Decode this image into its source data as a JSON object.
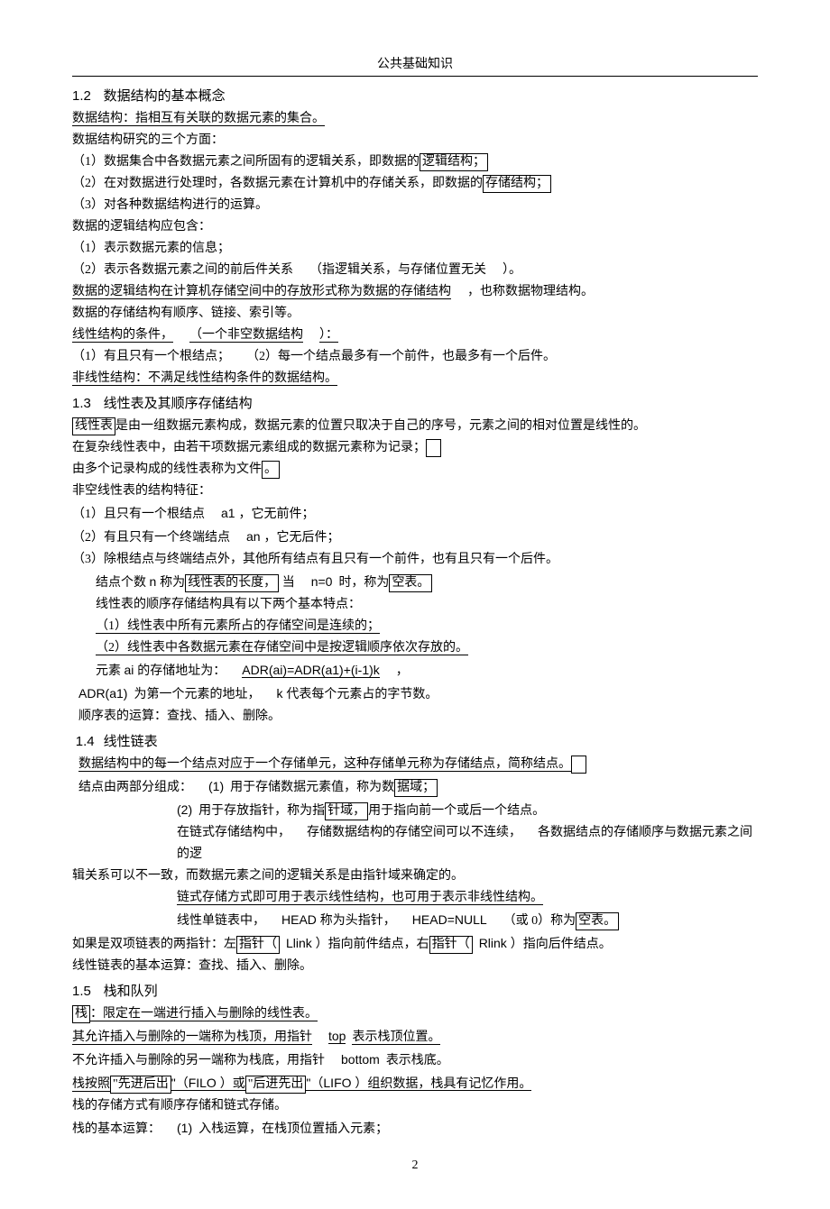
{
  "header": {
    "title": "公共基础知识"
  },
  "s12": {
    "num": "1.2",
    "title": "数据结构的基本概念",
    "p1a": "数据结构：指相互有关联的数据元素的集合。",
    "p2": "数据结构研究的三个方面：",
    "p3a": "（1）数据集合中各数据元素之间所固有的逻辑关系，即数据的",
    "p3b": "逻辑结构；",
    "p4a": "（2）在对数据进行处理时，各数据元素在计算机中的存储关系，即数据的",
    "p4b": "存储结构；",
    "p5": "（3）对各种数据结构进行的运算。",
    "p6": "数据的逻辑结构应包含：",
    "p7": "（1）表示数据元素的信息；",
    "p8a": "（2）表示各数据元素之间的前后件关系",
    "p8b": "（指逻辑关系，与存储位置无关",
    "p8c": "）。",
    "p9a": "数据的逻辑结构在计算机存储空间中的存放形式称为数据的存储结构",
    "p9b": "，也称数据物理结构。",
    "p10": "数据的存储结构有顺序、链接、索引等。",
    "p11a": "线性结构的条件，",
    "p11b": "（一个非空数据结构",
    "p11c": "）：",
    "p12a": "（1）有且只有一个根结点；",
    "p12b": "（2）每一个结点最多有一个前件，也最多有一个后件。",
    "p13a": "非线性结构：不满足线性结构条件的数据结构。"
  },
  "s13": {
    "num": "1.3",
    "title": "线性表及其顺序存储结构",
    "p1a": "线性表",
    "p1b": "是由一组数据元素构成，数据元素的位置只取决于自己的序号，元素之间的相对位置是线性的。",
    "p2a": "在复杂线性表中，由若干项数据元素组成的数据元素称为记录；",
    "p3a": "由多个记录构成的线性表称为文件",
    "p3b": "。",
    "p4": "非空线性表的结构特征：",
    "p5a": "（1）且只有一个根结点",
    "p5b": "a1 ，它无前件；",
    "p6a": "（2）有且只有一个终端结点",
    "p6b": "an ，它无后件；",
    "p7": "（3）除根结点与终端结点外，其他所有结点有且只有一个前件，也有且只有一个后件。",
    "p8a": "结点个数",
    "p8b": "n 称为",
    "p8c": "线性表的长度，",
    "p8d": "当",
    "p8e": "n=0",
    "p8f": "时，称为",
    "p8g": "空表。",
    "p9": "线性表的顺序存储结构具有以下两个基本特点：",
    "p10": "（1）线性表中所有元素所占的存储空间是连续的；",
    "p11": "（2）线性表中各数据元素在存储空间中是按逻辑顺序依次存放的。",
    "p12a": "元素",
    "p12b": "ai 的存储地址为：",
    "p12c": "ADR(ai)=ADR(a1)+(i-1)k",
    "p12d": "，",
    "p13a": "ADR(a1)",
    "p13b": "为第一个元素的地址，",
    "p13c": "k 代表每个元素占的字节数。",
    "p14": "顺序表的运算：查找、插入、删除。"
  },
  "s14": {
    "num": "1.4",
    "title": "线性链表",
    "p1a": "数据结构中的每一个结点对应于一个存储单元，这种存储单元称为存储结点，简称结点。",
    "p2a": "结点由两部分组成：",
    "p2b": "(1)",
    "p2c": "用于存储数据元素值，称为数",
    "p2d": "据域；",
    "p3a": "(2)",
    "p3b": "用于存放指针，称为指",
    "p3c": "针域，",
    "p3d": "用于指向前一个或后一个结点。",
    "p4a": "在链式存储结构中，",
    "p4b": "存储数据结构的存储空间可以不连续，",
    "p4c": "各数据结点的存储顺序与数据元素之间的逻",
    "p4d": "辑关系可以不一致，而数据元素之间的逻辑关系是由指针域来确定的。",
    "p5": "链式存储方式即可用于表示线性结构，也可用于表示非线性结构。",
    "p6a": "线性单链表中，",
    "p6b": "HEAD 称为头指针，",
    "p6c": "HEAD=NULL",
    "p6d": "（或 0）称为",
    "p6e": "空表。",
    "p7a": "如果是双项链表的两指针：左",
    "p7b": "指针（",
    "p7c": "Llink ）指向前件结点，右",
    "p7d": "指针（",
    "p7e": "Rlink ）指向后件结点。",
    "p8": "线性链表的基本运算：查找、插入、删除。"
  },
  "s15": {
    "num": "1.5",
    "title": "栈和队列",
    "p1a": "栈",
    "p1b": "：限定在一端进行插入与删除的线性表。",
    "p2a": "其允许插入与删除的一端称为栈顶，用指针",
    "p2b": "top",
    "p2c": "表示栈顶位置。",
    "p3a": "不允许插入与删除的另一端称为栈底，用指针",
    "p3b": "bottom",
    "p3c": "表示栈底。",
    "p4a": "栈按照",
    "p4b": "\"先进后出",
    "p4c": "\"（FILO ）或",
    "p4d": "\"后进先出",
    "p4e": "\"（LIFO ）组织数据，栈具有记忆作用。",
    "p5": "栈的存储方式有顺序存储和链式存储。",
    "p6a": "栈的基本运算：",
    "p6b": "(1)",
    "p6c": "入栈运算，在栈顶位置插入元素；"
  },
  "pagenum": "2"
}
